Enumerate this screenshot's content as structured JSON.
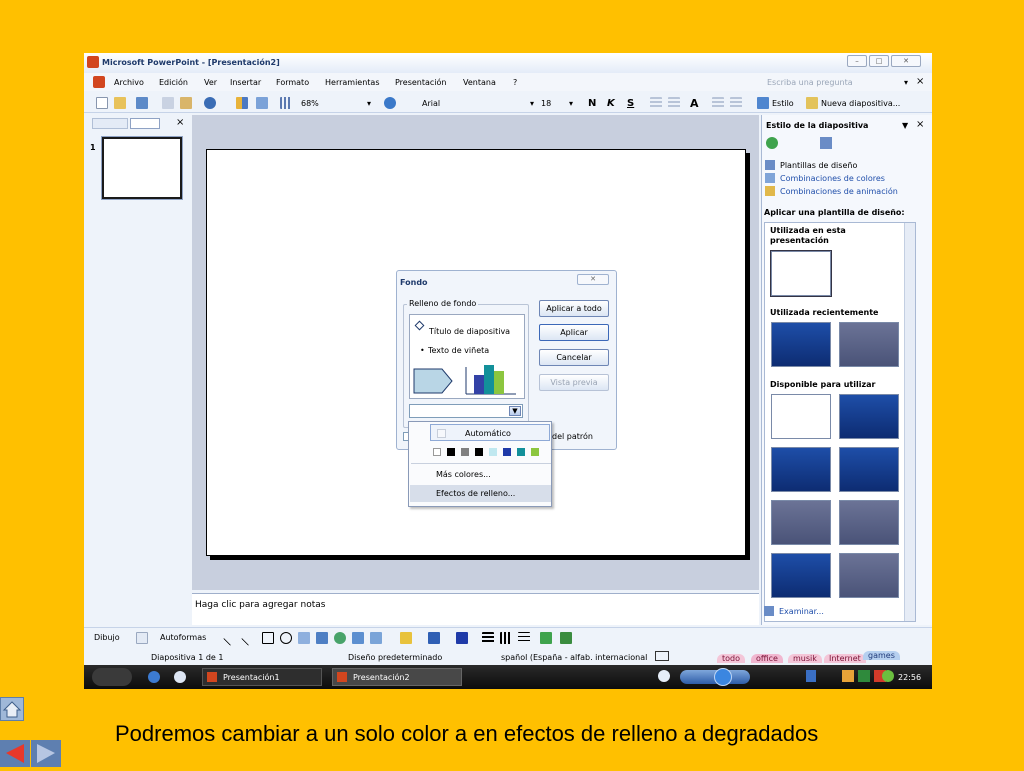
{
  "window": {
    "title": "Microsoft PowerPoint - [Presentación2]",
    "controls": [
      "minimize-icon",
      "maximize-icon",
      "close-icon"
    ]
  },
  "menubar": {
    "items": [
      "Archivo",
      "Edición",
      "Ver",
      "Insertar",
      "Formato",
      "Herramientas",
      "Presentación",
      "Ventana",
      "?"
    ],
    "search_placeholder": "Escriba una pregunta",
    "close_glyph": "×"
  },
  "toolbar": {
    "zoom": "68%",
    "font": "Arial",
    "size": "18",
    "bold": "N",
    "italic": "K",
    "underline": "S",
    "grow_font": "A",
    "style_label": "Estilo",
    "new_slide_label": "Nueva diapositiva..."
  },
  "leftpane": {
    "tab_close": "×",
    "slide_number": "1"
  },
  "notes": {
    "placeholder": "Haga clic para agregar notas"
  },
  "taskpane": {
    "title": "Estilo de la diapositiva",
    "links": [
      "Plantillas de diseño",
      "Combinaciones de colores",
      "Combinaciones de animación"
    ],
    "apply_heading": "Aplicar una plantilla de diseño:",
    "section_used": "Utilizada en esta presentación",
    "section_recent": "Utilizada recientemente",
    "section_available": "Disponible para utilizar",
    "browse": "Examinar..."
  },
  "dialog": {
    "title": "Fondo",
    "group_label": "Relleno de fondo",
    "preview_title": "Título de diapositiva",
    "preview_bullet": "Texto de viñeta",
    "checkbox_label_visible": "del patrón",
    "buttons": [
      "Aplicar a todo",
      "Aplicar",
      "Cancelar",
      "Vista previa"
    ]
  },
  "dropdown": {
    "automatic": "Automático",
    "more_colors": "Más colores...",
    "fill_effects": "Efectos de relleno...",
    "swatches": [
      "#FFFFFF",
      "#000000",
      "#808080",
      "#000000",
      "#C0E8F0",
      "#1F3AA8",
      "#13909A",
      "#8CC63F"
    ]
  },
  "drawbar": {
    "drawing": "Dibujo",
    "autoshapes": "Autoformas"
  },
  "statusbar": {
    "slide": "Diapositiva 1 de 1",
    "design": "Diseño predeterminado",
    "language": "spañol (España - alfab. internacional"
  },
  "taskbar": {
    "items": [
      "Presentación1",
      "Presentación2"
    ],
    "tags": [
      "todo",
      "office",
      "musik",
      "Internet",
      "games"
    ],
    "clock": "22:56"
  },
  "caption": "Podremos cambiar a un solo color a en efectos de relleno a degradados",
  "colors": {
    "background": "#FFC000",
    "window_chrome": "#EEF3FA",
    "title_text": "#1F3A6B",
    "link": "#1F4EAA"
  }
}
